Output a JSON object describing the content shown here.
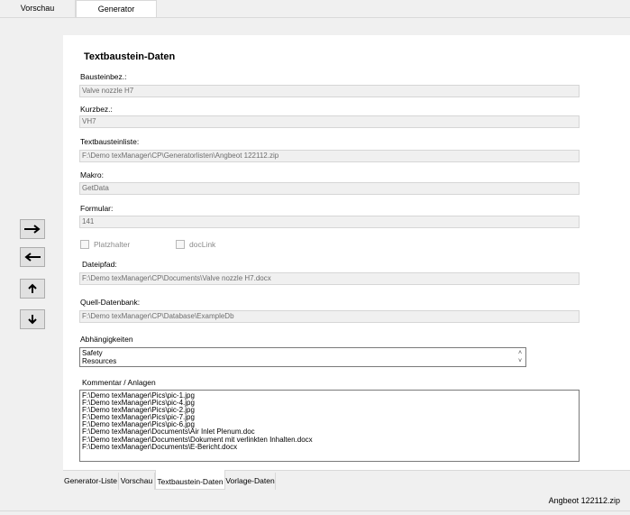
{
  "top_tabs": {
    "preview": "Vorschau",
    "generator": "Generator"
  },
  "title": "Textbaustein-Daten",
  "fields": {
    "bausteinbez": {
      "label": "Bausteinbez.:",
      "value": "Valve nozzle H7"
    },
    "kurzbez": {
      "label": "Kurzbez.:",
      "value": "VH7"
    },
    "textbausteinliste": {
      "label": "Textbausteinliste:",
      "value": "F:\\Demo texManager\\CP\\Generatorlisten\\Angbeot 122112.zip"
    },
    "makro": {
      "label": "Makro:",
      "value": "GetData"
    },
    "formular": {
      "label": "Formular:",
      "value": "141"
    },
    "dateipfad": {
      "label": "Dateipfad:",
      "value": "F:\\Demo texManager\\CP\\Documents\\Valve nozzle H7.docx"
    },
    "quell_db": {
      "label": "Quell-Datenbank:",
      "value": "F:\\Demo texManager\\CP\\Database\\ExampleDb"
    }
  },
  "checkboxes": {
    "platzhalter": "Platzhalter",
    "doclink": "docLink"
  },
  "dependencies": {
    "label": "Abhängigkeiten",
    "items": [
      "Safety",
      "Resources"
    ]
  },
  "comments": {
    "label": "Kommentar / Anlagen",
    "lines": [
      "F:\\Demo texManager\\Pics\\pic-1.jpg",
      "F:\\Demo texManager\\Pics\\pic-4.jpg",
      "F:\\Demo texManager\\Pics\\pic-2.jpg",
      "F:\\Demo texManager\\Pics\\pic-7.jpg",
      "F:\\Demo texManager\\Pics\\pic-6.jpg",
      "F:\\Demo texManager\\Documents\\Air Inlet Plenum.doc",
      "F:\\Demo texManager\\Documents\\Dokument mit verlinkten Inhalten.docx",
      "F:\\Demo texManager\\Documents\\E-Bericht.docx"
    ]
  },
  "bottom_tabs": {
    "generator_list": "Generator-Liste",
    "preview": "Vorschau",
    "textbaustein_daten": "Textbaustein-Daten",
    "vorlage_daten": "Vorlage-Daten"
  },
  "status": "Angbeot 122112.zip",
  "icons": {
    "arrow_right": "arrow-right-icon",
    "arrow_left": "arrow-left-icon",
    "arrow_up": "arrow-up-icon",
    "arrow_down": "arrow-down-icon"
  }
}
